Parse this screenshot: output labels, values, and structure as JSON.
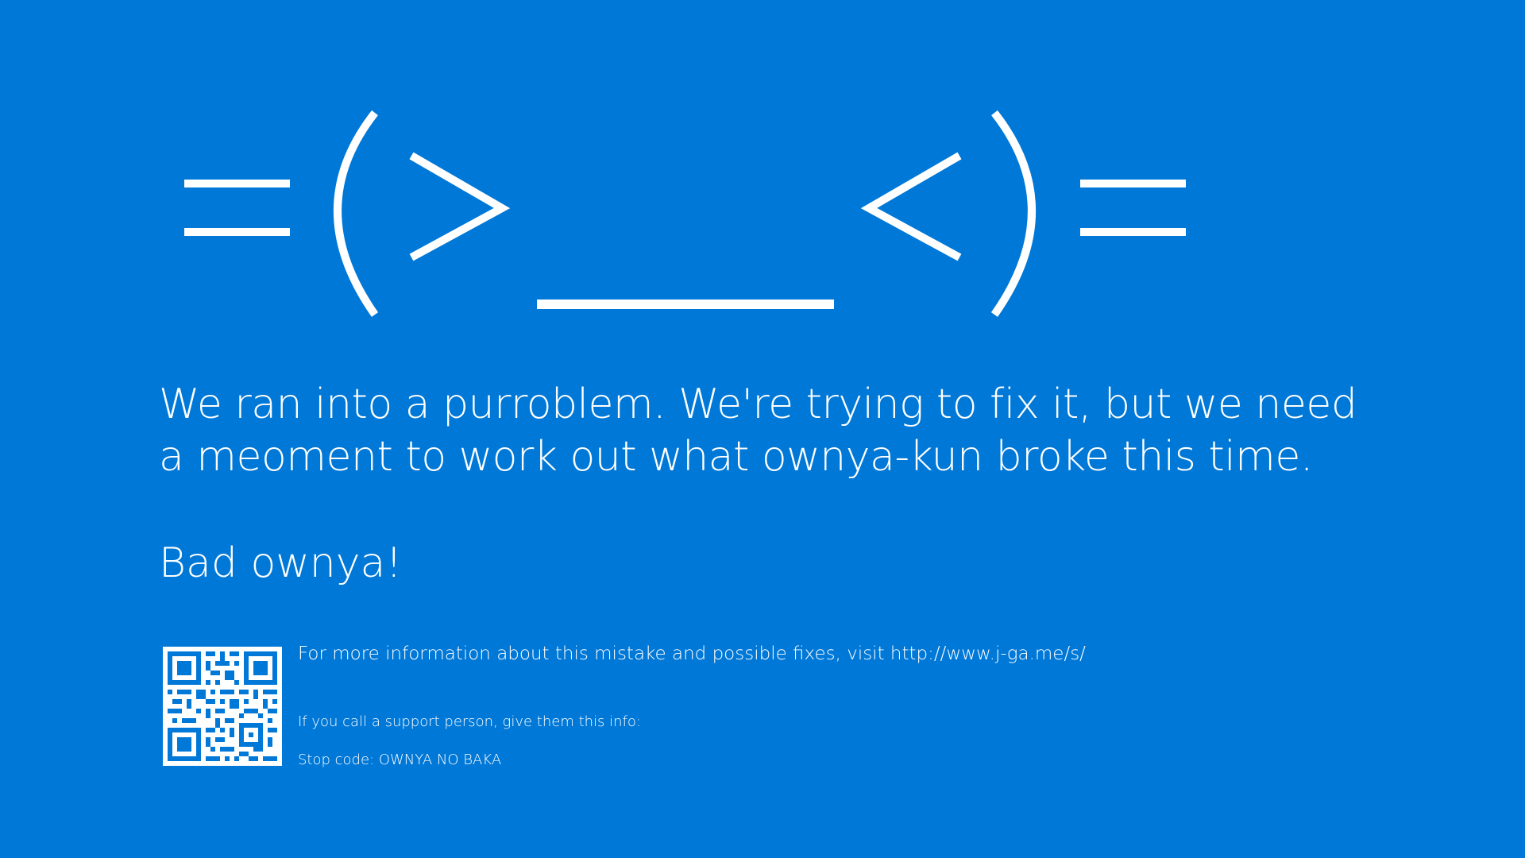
{
  "screen": {
    "background": "#0078d7",
    "foreground": "#ffffff"
  },
  "face": {
    "emoticon": "=(>___<)=",
    "icon": "sad-cat-emoticon-icon"
  },
  "message": {
    "line1": "We ran into a purroblem. We're trying to fix it, but we need",
    "line2": "a meoment to work out what ownya-kun broke this time."
  },
  "scold": "Bad ownya!",
  "qr": {
    "icon": "qr-code-icon"
  },
  "info": "For more information about this mistake and possible fixes, visit http://www.j-ga.me/s/",
  "support": "If you call a support person, give them this info:",
  "stop_code": "Stop code: OWNYA NO BAKA"
}
